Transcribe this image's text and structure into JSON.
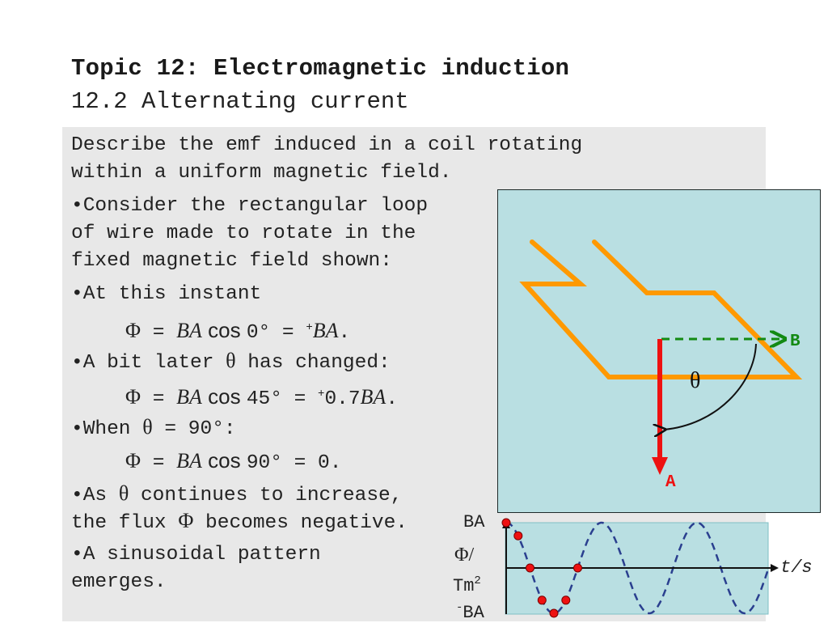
{
  "header": {
    "title": "Topic 12: Electromagnetic induction",
    "subtitle": "12.2 Alternating current"
  },
  "content": {
    "intro_line1": "Describe the emf induced in a coil rotating",
    "intro_line2": "within a uniform magnetic field.",
    "bullet1_line1": "•Consider the rectangular loop",
    "bullet1_line2": "of wire made to rotate in the",
    "bullet1_line3": "fixed magnetic field shown:",
    "bullet2": "•At this instant",
    "eq1": {
      "phi": "Φ",
      "eq": " = ",
      "ba": "BA",
      "cos": " cos ",
      "rest": "0° = ",
      "sup": "+",
      "result": "BA",
      "end": "."
    },
    "bullet3_pre": "•A bit later ",
    "bullet3_theta": "θ",
    "bullet3_post": " has changed:",
    "eq2": {
      "phi": "Φ",
      "eq": " = ",
      "ba": "BA",
      "cos": " cos ",
      "rest": "45° = ",
      "sup": "+",
      "num": "0.7",
      "result": "BA",
      "end": "."
    },
    "bullet4_pre": "•When ",
    "bullet4_theta": "θ",
    "bullet4_post": " = 90°:",
    "eq3": {
      "phi": "Φ",
      "eq": " = ",
      "ba": "BA",
      "cos": " cos ",
      "rest": "90° = 0."
    },
    "bullet5_pre": "•As ",
    "bullet5_theta": "θ",
    "bullet5_post": " continues to increase,",
    "bullet5_line2_pre": "the flux ",
    "bullet5_line2_phi": "Φ",
    "bullet5_line2_post": "  becomes negative.",
    "bullet6_line1": "•A sinusoidal pattern",
    "bullet6_line2": "emerges."
  },
  "diagram": {
    "label_b": "B",
    "label_a": "A",
    "label_theta": "θ",
    "colors": {
      "loop": "#ff9900",
      "field": "#138a13",
      "area_vector": "#ee1111",
      "background": "#b9dfe2"
    }
  },
  "chart_data": {
    "type": "line",
    "title": "",
    "xlabel": "t/s",
    "ylabel_phi": "Φ/",
    "ylabel_unit": "Tm",
    "ylabel_unit_sup": "2",
    "ytick_top": "BA",
    "ytick_bottom_sup": "-",
    "ytick_bottom": "BA",
    "ylim": [
      -1,
      1
    ],
    "curve": "Φ = BA cos θ",
    "cycles_shown": 2.75,
    "series": [
      {
        "name": "flux (cosine, dashed)",
        "function": "cos",
        "color": "#2a3f8f"
      },
      {
        "name": "sample points",
        "theta_deg": [
          0,
          45,
          90,
          135,
          180,
          225,
          270
        ],
        "values": [
          1,
          0.71,
          0,
          -0.71,
          -1,
          -0.71,
          0
        ],
        "color": "#ee1111"
      }
    ]
  }
}
